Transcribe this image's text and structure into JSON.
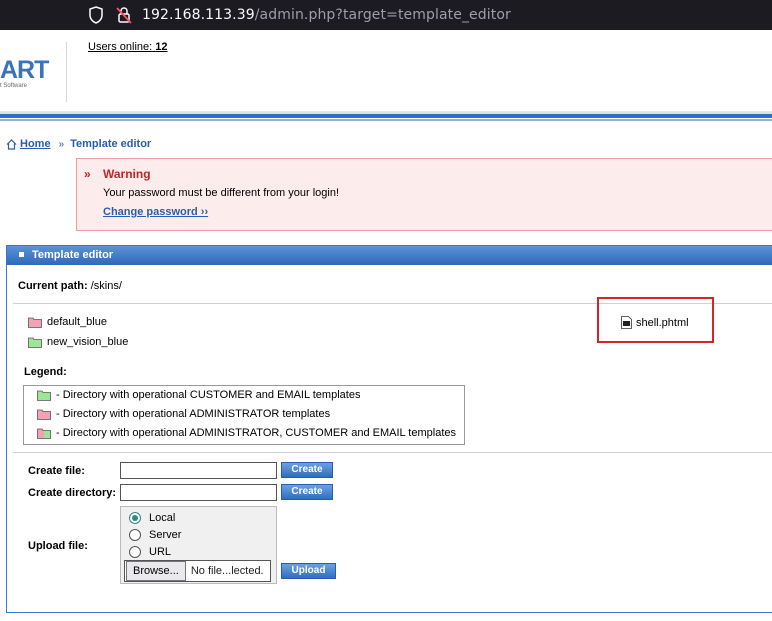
{
  "browser": {
    "url_host": "192.168.113.39",
    "url_path": "/admin.php?target=template_editor"
  },
  "header": {
    "logo_text": "ART",
    "logo_sub": "t Software",
    "users_online_label": "Users online:",
    "users_online_count": "12"
  },
  "breadcrumb": {
    "home": "Home",
    "current": "Template editor"
  },
  "warning": {
    "title": "Warning",
    "message": "Your password must be different from your login!",
    "link": "Change password ››"
  },
  "panel": {
    "title": "Template editor",
    "current_path_label": "Current path:",
    "current_path_value": " /skins/",
    "directories": [
      {
        "name": "default_blue",
        "color": "#f5a0b4"
      },
      {
        "name": "new_vision_blue",
        "color": "#9ee59a"
      }
    ],
    "file": "shell.phtml",
    "legend_label": "Legend:",
    "legend": [
      {
        "text": "- Directory with operational CUSTOMER and EMAIL templates",
        "color": "#9ee59a"
      },
      {
        "text": "- Directory with operational ADMINISTRATOR templates",
        "color": "#f5a0b4"
      },
      {
        "text": "- Directory with operational ADMINISTRATOR, CUSTOMER and EMAIL templates",
        "color": "mixed"
      }
    ],
    "create_file_label": "Create file:",
    "create_dir_label": "Create directory:",
    "create_button": "Create",
    "upload_label": "Upload file:",
    "upload_options": [
      "Local",
      "Server",
      "URL"
    ],
    "upload_selected": "Local",
    "browse_button": "Browse...",
    "no_file_text": "No file...lected.",
    "upload_button": "Upload"
  },
  "colors": {
    "accent_blue": "#2e68b9",
    "warning_red": "#c0262a",
    "highlight_box": "#d8232a"
  }
}
